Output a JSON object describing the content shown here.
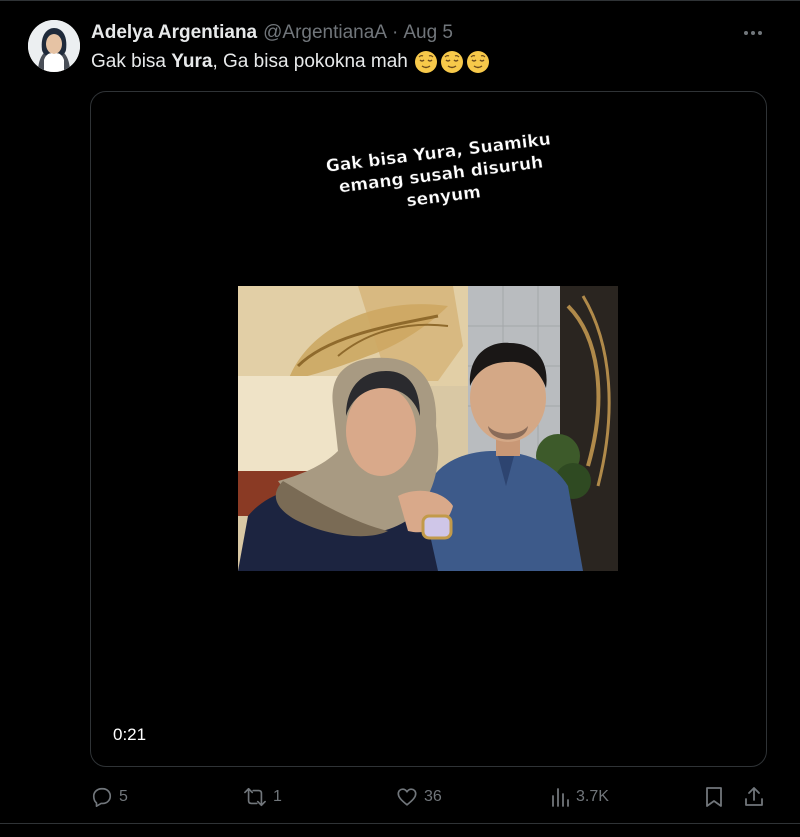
{
  "author": {
    "display_name": "Adelya Argentiana",
    "handle": "@ArgentianaA",
    "separator": "·",
    "date": "Aug 5"
  },
  "tweet": {
    "text_before": "Gak bisa ",
    "text_bold": "Yura",
    "text_after": ", Ga bisa pokokna mah",
    "emojis": [
      "relieved-face-emoji",
      "relieved-face-emoji",
      "relieved-face-emoji"
    ]
  },
  "media": {
    "caption_lines": [
      "Gak bisa Yura, Suamiku",
      "emang susah disuruh",
      "senyum"
    ],
    "duration": "0:21"
  },
  "actions": {
    "reply_count": "5",
    "retweet_count": "1",
    "like_count": "36",
    "views_count": "3.7K"
  },
  "colors": {
    "background": "#000000",
    "primary_text": "#e7e9ea",
    "secondary_text": "#71767b",
    "border": "#2f3336"
  },
  "icons": {
    "more": "more-horizontal-icon",
    "reply": "reply-icon",
    "retweet": "retweet-icon",
    "like": "heart-icon",
    "views": "views-icon",
    "bookmark": "bookmark-icon",
    "share": "share-icon"
  }
}
